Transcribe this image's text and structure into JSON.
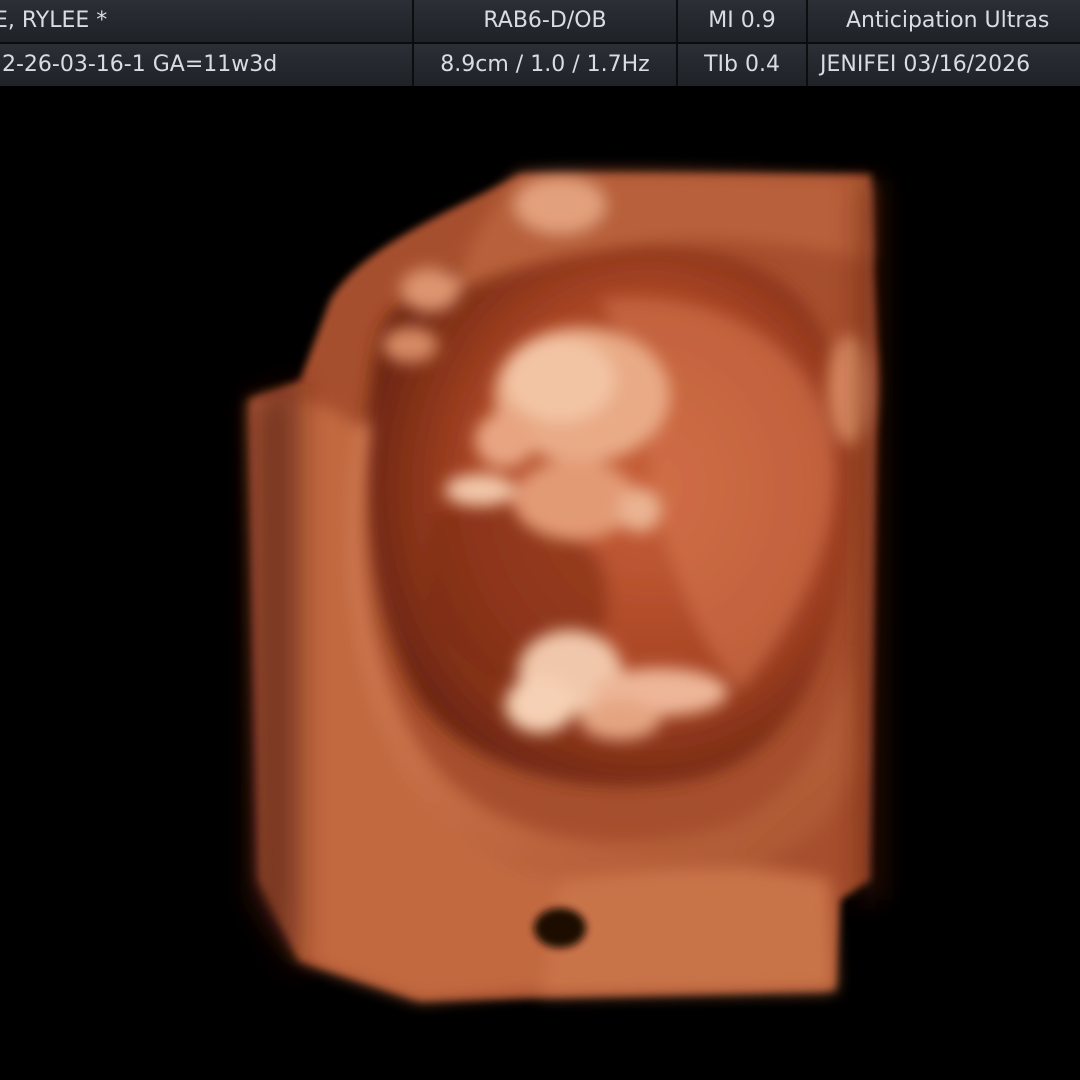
{
  "header": {
    "row1": {
      "patient": "E, RYLEE  *",
      "probe_preset": "RAB6-D/OB",
      "mi": "MI  0.9",
      "facility": "Anticipation Ultras"
    },
    "row2": {
      "exam_id_ga": "2-26-03-16-1  GA=11w3d",
      "depth_params": "8.9cm / 1.0 / 1.7Hz",
      "tib": "TIb  0.4",
      "operator_date": "JENIFEI  03/16/2026"
    }
  },
  "viewport": {
    "mode": "3D volume render",
    "colors": {
      "background": "#000000",
      "tissue_dark": "#5a1c0c",
      "tissue_mid": "#a84424",
      "tissue_light": "#e0906a",
      "highlight": "#f6d0b4"
    }
  }
}
